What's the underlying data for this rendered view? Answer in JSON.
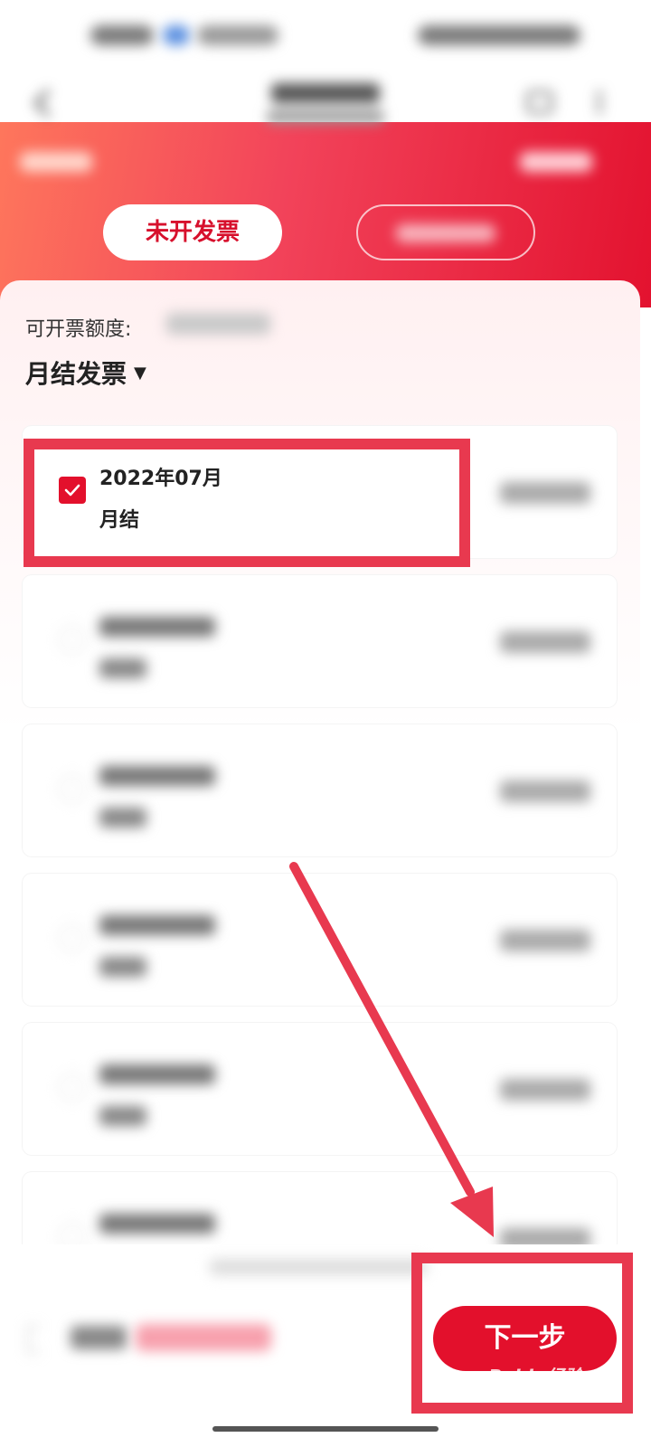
{
  "tabs": {
    "unissued_label": "未开发票"
  },
  "summary": {
    "quota_label": "可开票额度:"
  },
  "invoice_type": {
    "label": "月结发票",
    "caret": "▼"
  },
  "invoices": [
    {
      "period": "2022年07月",
      "kind": "月结",
      "selected": true
    }
  ],
  "footer": {
    "next_label": "下一步"
  },
  "watermark": "Baidu经验",
  "colors": {
    "brand_red": "#e3102c",
    "annotation_red": "#e8394f"
  }
}
